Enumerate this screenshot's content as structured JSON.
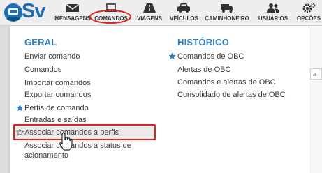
{
  "brand": {
    "logo_text": "Sv"
  },
  "nav": [
    {
      "icon": "envelope-icon",
      "label": "MENSAGENS"
    },
    {
      "icon": "laptop-icon",
      "label": "COMANDOS"
    },
    {
      "icon": "road-icon",
      "label": "VIAGENS"
    },
    {
      "icon": "car-icon",
      "label": "VEÍCULOS"
    },
    {
      "icon": "truck-icon",
      "label": "CAMINHONEIRO"
    },
    {
      "icon": "users-icon",
      "label": "USUÁRIOS"
    },
    {
      "icon": "gears-icon",
      "label": "OPÇÕES"
    }
  ],
  "menu": {
    "geral": {
      "title": "GERAL",
      "items": [
        {
          "label": "Enviar comando",
          "starred": false
        },
        {
          "label": "Comandos",
          "starred": false
        },
        {
          "label": "Importar comandos",
          "starred": false
        },
        {
          "label": "Exportar comandos",
          "starred": false
        },
        {
          "label": "Perfis de comando",
          "starred": true
        },
        {
          "label": "Entradas e saídas",
          "starred": false
        },
        {
          "label": "Associar comandos a perfis",
          "starred": false,
          "star_outline": true,
          "highlighted": true
        },
        {
          "label": "Associar comandos a status de",
          "label_line2": "acionamento",
          "starred": false
        }
      ]
    },
    "historico": {
      "title": "HISTÓRICO",
      "items": [
        {
          "label": "Comandos de OBC",
          "starred": true
        },
        {
          "label": "Alertas de OBC",
          "starred": false
        },
        {
          "label": "Comandos e alertas de OBC",
          "starred": false
        },
        {
          "label": "Consolidado de alertas de OBC",
          "starred": false
        }
      ]
    }
  },
  "underlying": {
    "box_text": "a"
  },
  "colors": {
    "accent": "#2f7fc1",
    "highlight": "#d9251d",
    "star": "#2f7fc1"
  }
}
